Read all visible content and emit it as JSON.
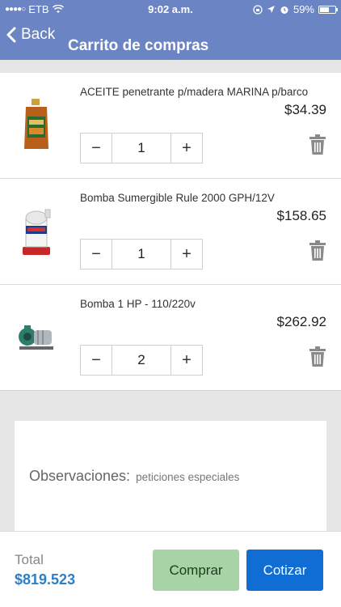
{
  "status_bar": {
    "carrier": "ETB",
    "time": "9:02 a.m.",
    "battery": "59%",
    "battery_level": 0.59
  },
  "nav": {
    "back_label": "Back",
    "title": "Carrito de compras"
  },
  "cart": {
    "items": [
      {
        "name": "ACEITE penetrante p/madera MARINA p/barco",
        "price": "$34.39",
        "qty": "1",
        "image_icon": "oil-bottle-icon"
      },
      {
        "name": "Bomba Sumergible Rule 2000 GPH/12V",
        "price": "$158.65",
        "qty": "1",
        "image_icon": "bilge-pump-icon"
      },
      {
        "name": "Bomba 1 HP - 110/220v",
        "price": "$262.92",
        "qty": "2",
        "image_icon": "water-pump-icon"
      }
    ],
    "minus_label": "−",
    "plus_label": "+"
  },
  "observations": {
    "label": "Observaciones:",
    "placeholder": "peticiones especiales"
  },
  "footer": {
    "total_label": "Total",
    "total_value": "$819.523",
    "buy_label": "Comprar",
    "quote_label": "Cotizar"
  },
  "colors": {
    "header": "#6b84c3",
    "total": "#2d7fc7",
    "buy": "#a7d3a7",
    "quote": "#0f6dd3"
  }
}
